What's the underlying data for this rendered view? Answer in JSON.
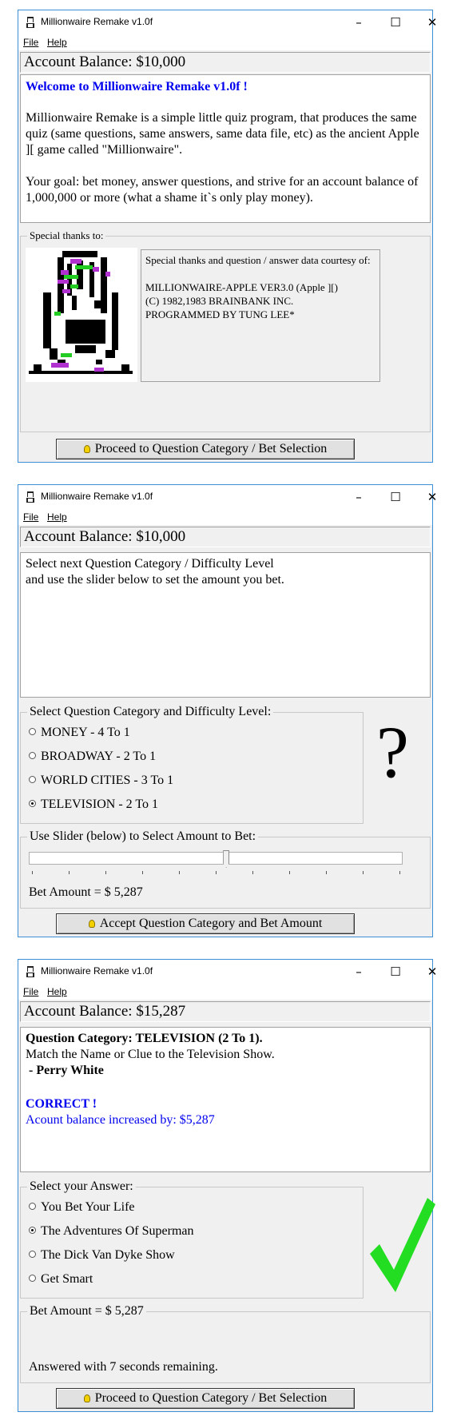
{
  "window_title": "Millionwaire Remake v1.0f",
  "menu": {
    "file": "File",
    "help": "Help"
  },
  "screen1": {
    "balance": "Account Balance: $10,000",
    "welcome_heading": "Welcome to Millionwaire Remake v1.0f !",
    "intro": "Millionwaire Remake is a simple little quiz program, that produces the same quiz (same questions, same answers, same data file, etc) as the ancient Apple ][ game called \"Millionwaire\".",
    "goal": "Your goal: bet money, answer questions, and strive for an account balance of 1,000,000 or more (what a shame it`s only play money).",
    "thanks_legend": "Special thanks to:",
    "credits_line1": "Special thanks and question / answer data courtesy of:",
    "credits_line2": "MILLIONWAIRE-APPLE VER3.0  (Apple ][)",
    "credits_line3": "(C) 1982,1983 BRAINBANK INC.",
    "credits_line4": "PROGRAMMED BY TUNG LEE*",
    "proceed_button": "Proceed to Question Category / Bet Selection"
  },
  "screen2": {
    "balance": "Account Balance: $10,000",
    "instructions_line1": "Select next Question Category / Difficulty Level",
    "instructions_line2": "and use the slider below to set the amount you bet.",
    "category_legend": "Select Question Category and Difficulty Level:",
    "categories": [
      {
        "label": "MONEY - 4 To 1",
        "selected": false
      },
      {
        "label": "BROADWAY - 2 To 1",
        "selected": false
      },
      {
        "label": "WORLD CITIES - 3 To 1",
        "selected": false
      },
      {
        "label": "TELEVISION - 2 To 1",
        "selected": true
      }
    ],
    "question_mark": "?",
    "slider_legend": "Use Slider (below) to Select Amount to Bet:",
    "slider_fraction": 0.5287,
    "bet_amount": "Bet Amount = $ 5,287",
    "accept_button": "Accept Question Category and Bet Amount"
  },
  "screen3": {
    "balance": "Account Balance: $15,287",
    "category_line": "Question Category: TELEVISION  (2 To 1).",
    "question_line": "Match the Name or Clue to the Television Show.",
    "clue": " - Perry White",
    "result": "CORRECT !",
    "increase": "Acount balance increased by: $5,287",
    "answer_legend": "Select your Answer:",
    "answers": [
      {
        "label": "You Bet Your Life",
        "selected": false
      },
      {
        "label": "The Adventures Of Superman",
        "selected": true
      },
      {
        "label": "The Dick Van Dyke Show",
        "selected": false
      },
      {
        "label": "Get Smart",
        "selected": false
      }
    ],
    "bet_legend": "Bet Amount = $ 5,287",
    "time_remaining": "Answered with 7 seconds remaining.",
    "proceed_button": "Proceed to Question Category / Bet Selection"
  },
  "colors": {
    "accent_blue": "#0000ee",
    "check_green": "#22dd22",
    "window_border": "#3c8fd6"
  }
}
